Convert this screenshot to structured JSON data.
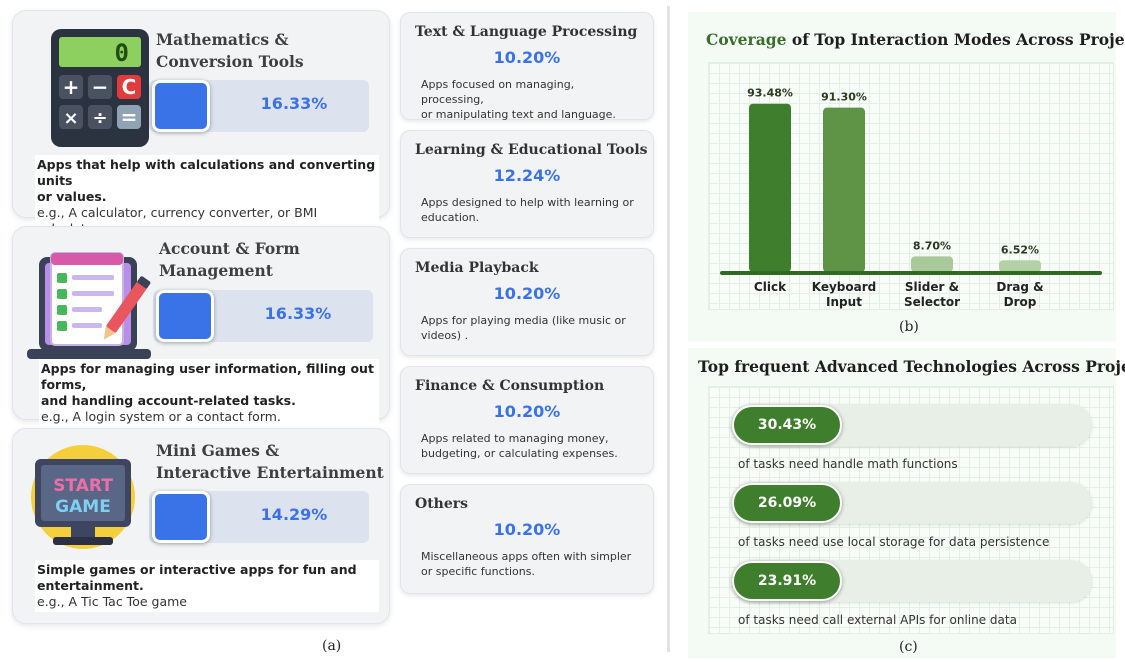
{
  "categories": [
    {
      "title_line1": "Mathematics &",
      "title_line2": "Conversion Tools",
      "percent": "16.33%",
      "desc_bold_line1": "Apps that help with calculations and converting units",
      "desc_bold_line2": "or values.",
      "example": "e.g., A calculator, currency converter, or BMI calculator.",
      "calc_display": "0",
      "calc_keys": [
        "+",
        "−",
        "C",
        "×",
        "÷",
        "="
      ]
    },
    {
      "title_line1": "Account & Form",
      "title_line2": "Management",
      "percent": "16.33%",
      "desc_bold_line1": "Apps for managing user information, filling out forms,",
      "desc_bold_line2": "and handling account-related tasks.",
      "example": "e.g.,  A login system or a contact form."
    },
    {
      "title_line1": "Mini Games &",
      "title_line2": "Interactive Entertainment",
      "percent": "14.29%",
      "desc_bold_line1": "Simple games or interactive apps for fun and",
      "desc_bold_line2": "entertainment.",
      "example": "e.g., A Tic Tac Toe game",
      "screen_line1": "START",
      "screen_line2": "GAME"
    }
  ],
  "small_categories": [
    {
      "title": "Text & Language Processing",
      "percent": "10.20%",
      "desc_line1": "Apps focused on managing, processing,",
      "desc_line2": "or manipulating text and language."
    },
    {
      "title": "Learning & Educational Tools",
      "percent": "12.24%",
      "desc_line1": "Apps designed to help with learning or",
      "desc_line2": "education."
    },
    {
      "title": "Media Playback",
      "percent": "10.20%",
      "desc_line1": "Apps for playing media (like music or",
      "desc_line2": "videos) ."
    },
    {
      "title": "Finance & Consumption",
      "percent": "10.20%",
      "desc_line1": "Apps related to managing money,",
      "desc_line2": "budgeting, or calculating expenses."
    },
    {
      "title": "Others",
      "percent": "10.20%",
      "desc_line1": "Miscellaneous apps often with simpler",
      "desc_line2": "or specific functions."
    }
  ],
  "captions": {
    "a": "(a)",
    "b": "(b)",
    "c": "(c)"
  },
  "panel_b": {
    "title_highlight": "Coverage",
    "title_rest": " of Top Interaction Modes Across Projects"
  },
  "panel_c": {
    "title": "Top frequent Advanced Technologies Across Projects"
  },
  "chart_data": [
    {
      "type": "bar",
      "title": "Coverage of Top Interaction Modes Across Projects",
      "categories": [
        [
          "Click"
        ],
        [
          "Keyboard",
          "Input"
        ],
        [
          "Slider &",
          "Selector"
        ],
        [
          "Drag &",
          "Drop"
        ]
      ],
      "values": [
        93.48,
        91.3,
        8.7,
        6.52
      ],
      "value_labels": [
        "93.48%",
        "91.30%",
        "8.70%",
        "6.52%"
      ],
      "ylim": [
        0,
        100
      ],
      "grid": true,
      "colors": [
        "#3f7e2c",
        "#5f9447",
        "#a9c99a",
        "#b4d1a6"
      ]
    },
    {
      "type": "bar",
      "title": "Top frequent Advanced Technologies Across Projects",
      "orientation": "horizontal",
      "categories": [
        "of tasks need handle math functions",
        "of tasks need use local storage for data persistence",
        "of tasks need call external APIs for online data"
      ],
      "values": [
        30.43,
        26.09,
        23.91
      ],
      "value_labels": [
        "30.43%",
        "26.09%",
        "23.91%"
      ],
      "color": "#3f7e2c"
    },
    {
      "type": "bar",
      "title": "",
      "categories": [
        "Mathematics & Conversion Tools",
        "Account & Form Management",
        "Mini Games & Interactive Entertainment",
        "Text & Language Processing",
        "Learning & Educational Tools",
        "Media Playback",
        "Finance & Consumption",
        "Others"
      ],
      "values": [
        16.33,
        16.33,
        14.29,
        10.2,
        12.24,
        10.2,
        10.2,
        10.2
      ]
    }
  ]
}
